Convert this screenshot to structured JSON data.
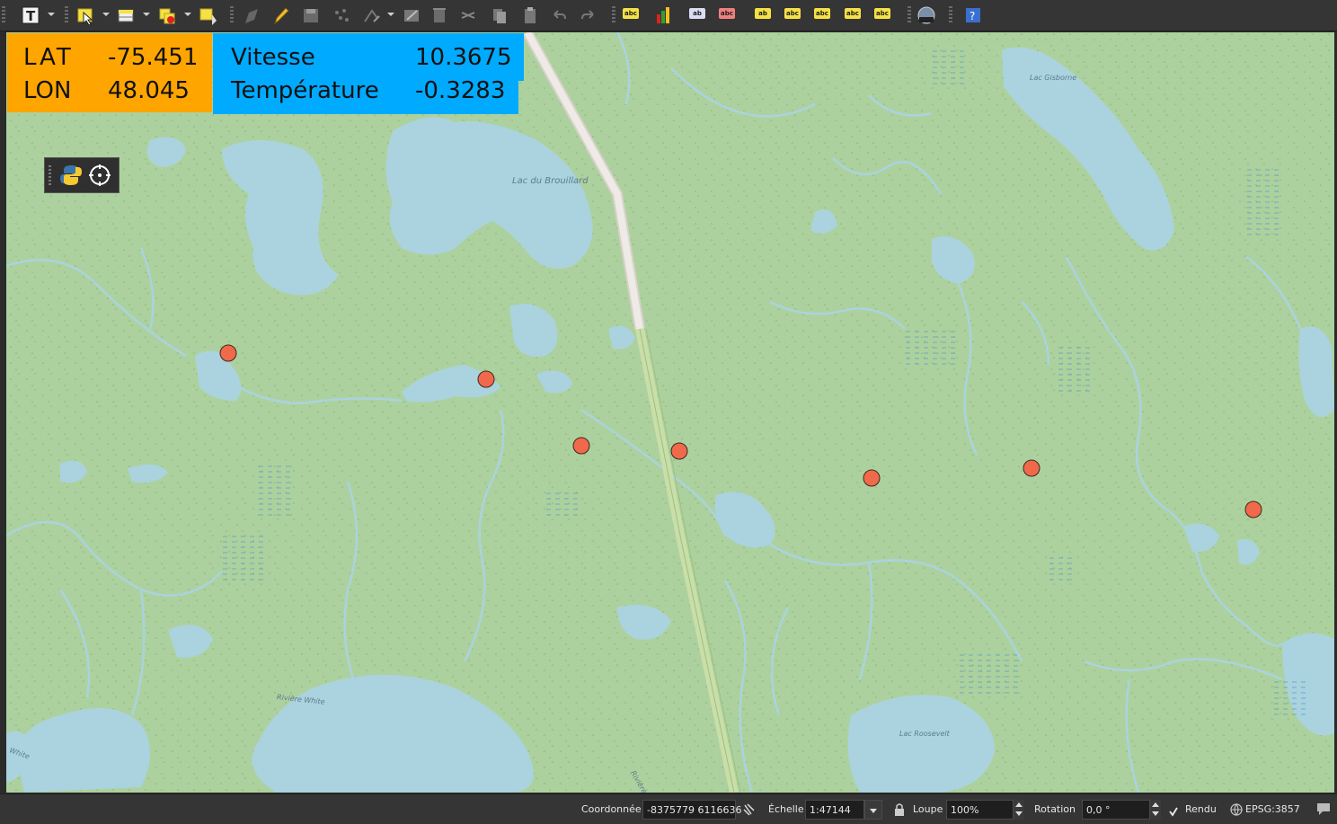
{
  "overlay": {
    "lat_label": "LAT",
    "lat_value": "-75.451",
    "lon_label": "LON",
    "lon_value": "48.045",
    "speed_label": "Vitesse",
    "speed_value": "10.3675",
    "temp_label": "Température",
    "temp_value": "-0.3283"
  },
  "map": {
    "labels": [
      "Lac du Brouillard",
      "Lac Gisborne",
      "Rivière White",
      "White",
      "Lac Roosevelt",
      "Rivière"
    ]
  },
  "status_bar": {
    "coordinate_label": "Coordonnée",
    "coordinate_value": "-8375779 6116636",
    "scale_label": "Échelle",
    "scale_value": "1:47144",
    "magnifier_label": "Loupe",
    "magnifier_value": "100%",
    "rotation_label": "Rotation",
    "rotation_value": "0,0 °",
    "render_label": "Rendu",
    "crs_label": "EPSG:3857"
  },
  "icons": {
    "toolbar": [
      "text-annotation-icon",
      "select-features-icon",
      "attribute-table-icon",
      "deselect-icon",
      "select-by-location-icon",
      "edit-pencil-icon",
      "toggle-editing-icon",
      "save-edits-icon",
      "add-feature-icon",
      "vertex-tool-icon",
      "modify-attributes-icon",
      "delete-selected-icon",
      "cut-features-icon",
      "copy-features-icon",
      "paste-features-icon",
      "undo-icon",
      "redo-icon",
      "label-icon",
      "diagram-icon",
      "pin-label-icon",
      "show-hide-label-icon",
      "move-label-icon",
      "rotate-label-icon",
      "change-label-icon",
      "label-properties-icon",
      "gps-tracker-icon",
      "help-icon"
    ],
    "colors": {
      "orange_panel": "#ffa500",
      "blue_panel": "#00aaff",
      "gps_point": "#f0694a",
      "map_bg": "#add19e",
      "water": "#aad3df"
    }
  }
}
